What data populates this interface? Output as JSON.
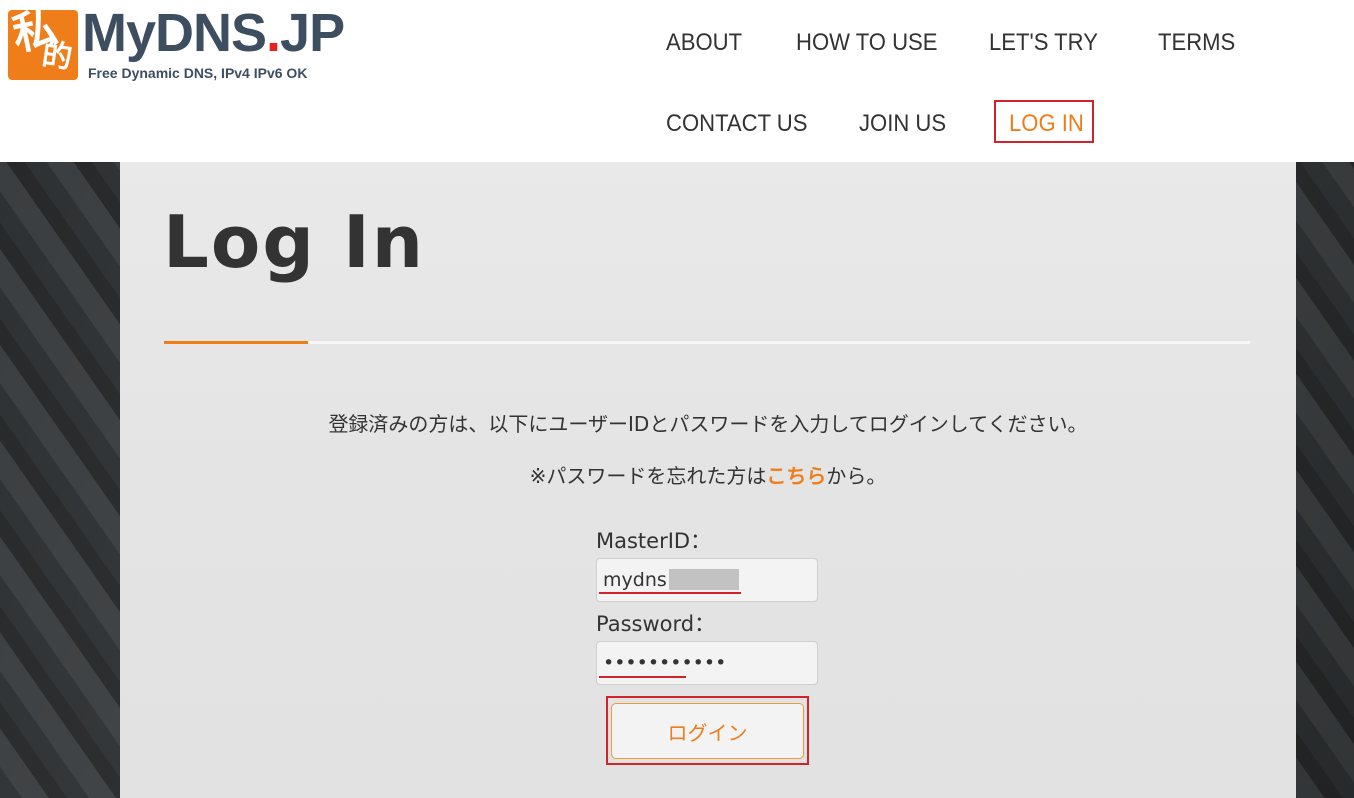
{
  "header": {
    "logo": {
      "kanji_top": "私",
      "kanji_bottom": "的",
      "name_main": "MyDNS",
      "name_dot": ".",
      "name_suffix": "JP",
      "tagline": "Free Dynamic DNS, IPv4 IPv6 OK"
    },
    "nav": {
      "about": "ABOUT",
      "how_to_use": "HOW TO USE",
      "lets_try": "LET'S TRY",
      "terms": "TERMS",
      "contact_us": "CONTACT US",
      "join_us": "JOIN US",
      "log_in": "LOG IN",
      "active": "log_in"
    }
  },
  "main": {
    "title": "Log In",
    "intro": "登録済みの方は、以下にユーザーIDとパスワードを入力してログインしてください。",
    "forgot_prefix": "※パスワードを忘れた方は",
    "forgot_link": "こちら",
    "forgot_suffix": "から。",
    "form": {
      "master_id_label": "MasterID：",
      "master_id_value": "mydns",
      "password_label": "Password：",
      "password_value": "•••••••••••",
      "submit_label": "ログイン"
    }
  },
  "colors": {
    "accent": "#ef7d1a",
    "highlight_box": "#d0232a",
    "logo_text": "#3d4e61"
  }
}
